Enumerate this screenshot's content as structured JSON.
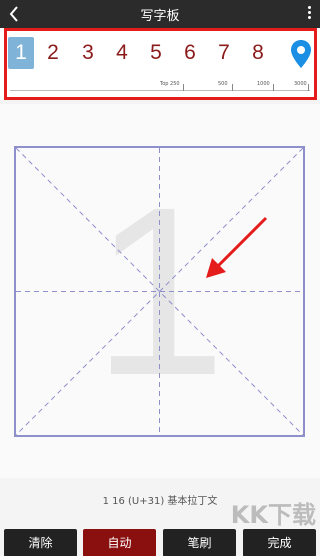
{
  "header": {
    "title": "写字板",
    "back_icon": "chevron-left-icon",
    "menu_icon": "more-vertical-icon"
  },
  "char_selector": {
    "items": [
      "1",
      "2",
      "3",
      "4",
      "5",
      "6",
      "7",
      "8"
    ],
    "selected": "1",
    "location_icon": "map-pin-icon"
  },
  "scale": {
    "labels": [
      "Top 250",
      "500",
      "1000",
      "3000"
    ]
  },
  "practice": {
    "ghost_char": "1",
    "info": "1 16 (U+31) 基本拉丁文"
  },
  "watermark": "KK下载",
  "buttons": {
    "clear": "清除",
    "auto": "自动",
    "brush": "笔刷",
    "done": "完成"
  },
  "colors": {
    "accent_selected": "#7fb3d8",
    "char_color": "#8b1a1a",
    "highlight_box": "#e41c1c",
    "grid": "#8f8fcc",
    "auto_button": "#8a1010"
  }
}
